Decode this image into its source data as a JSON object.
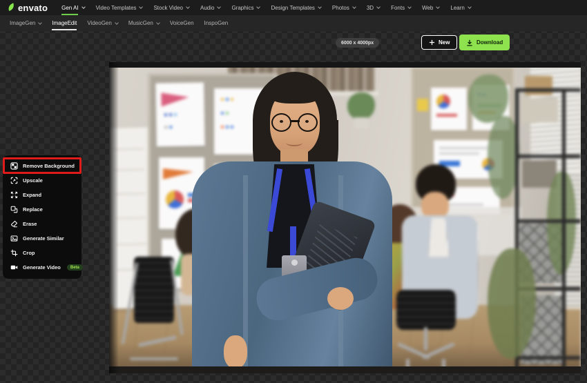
{
  "brand": {
    "name": "envato"
  },
  "top_nav": {
    "items": [
      {
        "label": "Gen AI",
        "dropdown": true,
        "active": true
      },
      {
        "label": "Video Templates",
        "dropdown": true
      },
      {
        "label": "Stock Video",
        "dropdown": true
      },
      {
        "label": "Audio",
        "dropdown": true
      },
      {
        "label": "Graphics",
        "dropdown": true
      },
      {
        "label": "Design Templates",
        "dropdown": true
      },
      {
        "label": "Photos",
        "dropdown": true
      },
      {
        "label": "3D",
        "dropdown": true
      },
      {
        "label": "Fonts",
        "dropdown": true
      },
      {
        "label": "Web",
        "dropdown": true
      },
      {
        "label": "Learn",
        "dropdown": true
      }
    ]
  },
  "sub_nav": {
    "items": [
      {
        "label": "ImageGen",
        "dropdown": true
      },
      {
        "label": "ImageEdit",
        "active": true
      },
      {
        "label": "VideoGen",
        "dropdown": true
      },
      {
        "label": "MusicGen",
        "dropdown": true
      },
      {
        "label": "VoiceGen"
      },
      {
        "label": "InspoGen"
      }
    ]
  },
  "toolbar": {
    "size_label": "6000 x 4000px",
    "new_label": "New",
    "download_label": "Download"
  },
  "tool_menu": {
    "items": [
      {
        "label": "Remove Background",
        "icon": "remove-background-icon",
        "highlighted": true
      },
      {
        "label": "Upscale",
        "icon": "upscale-icon"
      },
      {
        "label": "Expand",
        "icon": "expand-icon"
      },
      {
        "label": "Replace",
        "icon": "replace-icon"
      },
      {
        "label": "Erase",
        "icon": "erase-icon"
      },
      {
        "label": "Generate Similar",
        "icon": "generate-similar-icon"
      },
      {
        "label": "Crop",
        "icon": "crop-icon"
      },
      {
        "label": "Generate Video",
        "icon": "generate-video-icon",
        "badge": "Beta"
      }
    ]
  },
  "colors": {
    "accent_green": "#87e64b",
    "nav_active_underline": "#6fcf4a",
    "download_button_bg": "#8de24d",
    "highlight_red": "#e01b1b",
    "beta_badge_bg": "#24411d",
    "beta_badge_text": "#9fe24f"
  }
}
